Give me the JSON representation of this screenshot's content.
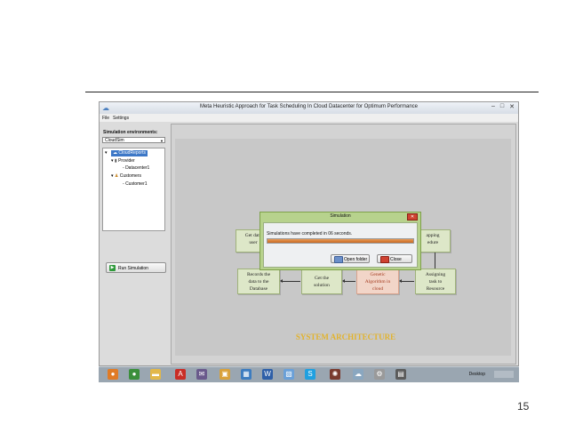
{
  "window": {
    "title": "Meta Heuristic Approach for Task Scheduling In Cloud Datacenter for Optimum Performance",
    "controls": [
      "–",
      "□",
      "✕"
    ]
  },
  "menu": {
    "file": "File",
    "settings": "Settings"
  },
  "sidebar": {
    "env_label": "Simulation environments:",
    "env_selected": "CloudSim",
    "tree": {
      "root": "CloudReports",
      "provider": "Provider",
      "datacenter": "Datacenter1",
      "customers": "Customers",
      "customer": "Customer1"
    },
    "run_button": "Run Simulation"
  },
  "diagram": {
    "get_data": [
      "Get data",
      "user"
    ],
    "mapping": [
      "apping",
      "edure"
    ],
    "records": [
      "Records the",
      "data to the",
      "Database"
    ],
    "get_solution": [
      "Get the",
      "solution"
    ],
    "genetic": [
      "Genetic",
      "Algorithm in",
      "cloud"
    ],
    "assigning": [
      "Assigning",
      "task to",
      "Resource"
    ],
    "title": "SYSTEM ARCHITECTURE"
  },
  "dialog": {
    "title": "Simulation",
    "message": "Simulations have completed in 06 seconds.",
    "progress": 1.0,
    "open_folder": "Open folder",
    "close": "Close"
  },
  "taskbar": {
    "desktop_label": "Desktop",
    "icons": [
      "firefox-icon",
      "chrome-icon",
      "folder-icon",
      "pdf-icon",
      "mail-icon",
      "explorer-icon",
      "paint-icon",
      "word-icon",
      "image-icon",
      "skype-icon",
      "seal-icon",
      "cloud-icon",
      "tools-icon",
      "app-icon"
    ]
  },
  "page_number": "15"
}
